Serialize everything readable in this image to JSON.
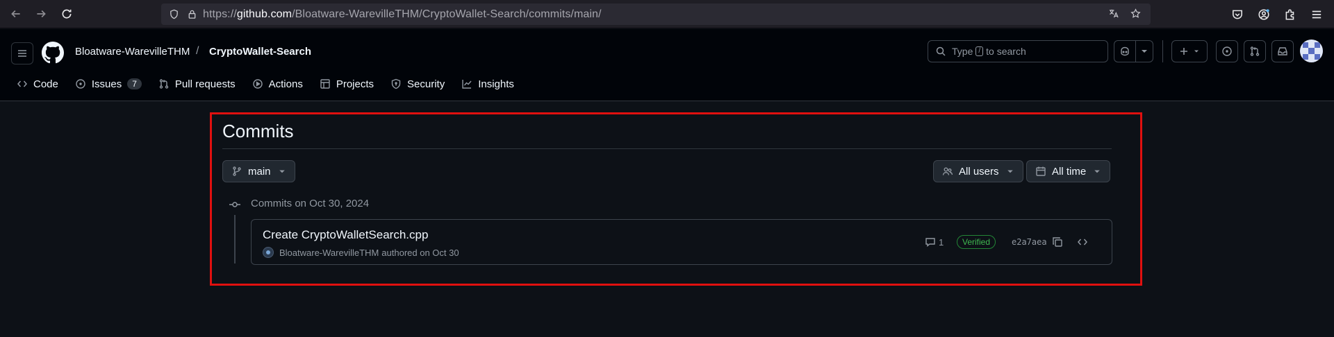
{
  "browser": {
    "url_prefix": "https://",
    "url_host": "github.com",
    "url_path": "/Bloatware-WarevilleTHM/CryptoWallet-Search/commits/main/"
  },
  "header": {
    "owner": "Bloatware-WarevilleTHM",
    "separator": "/",
    "repo": "CryptoWallet-Search",
    "search_type": "Type",
    "search_key": "/",
    "search_rest": "to search"
  },
  "tabs": [
    {
      "label": "Code",
      "icon": "code-icon"
    },
    {
      "label": "Issues",
      "icon": "issue-icon",
      "count": "7"
    },
    {
      "label": "Pull requests",
      "icon": "pull-request-icon"
    },
    {
      "label": "Actions",
      "icon": "play-icon"
    },
    {
      "label": "Projects",
      "icon": "table-icon"
    },
    {
      "label": "Security",
      "icon": "shield-icon"
    },
    {
      "label": "Insights",
      "icon": "graph-icon"
    }
  ],
  "main": {
    "title": "Commits",
    "branch": "main",
    "users_filter": "All users",
    "time_filter": "All time",
    "group_label": "Commits on Oct 30, 2024",
    "commit": {
      "title": "Create CryptoWalletSearch.cpp",
      "author": "Bloatware-WarevilleTHM",
      "meta": "authored on Oct 30",
      "comments": "1",
      "badge": "Verified",
      "sha": "e2a7aea"
    }
  },
  "colors": {
    "highlight": "#e0100f",
    "verified": "#3fb950",
    "background": "#0d1117"
  }
}
